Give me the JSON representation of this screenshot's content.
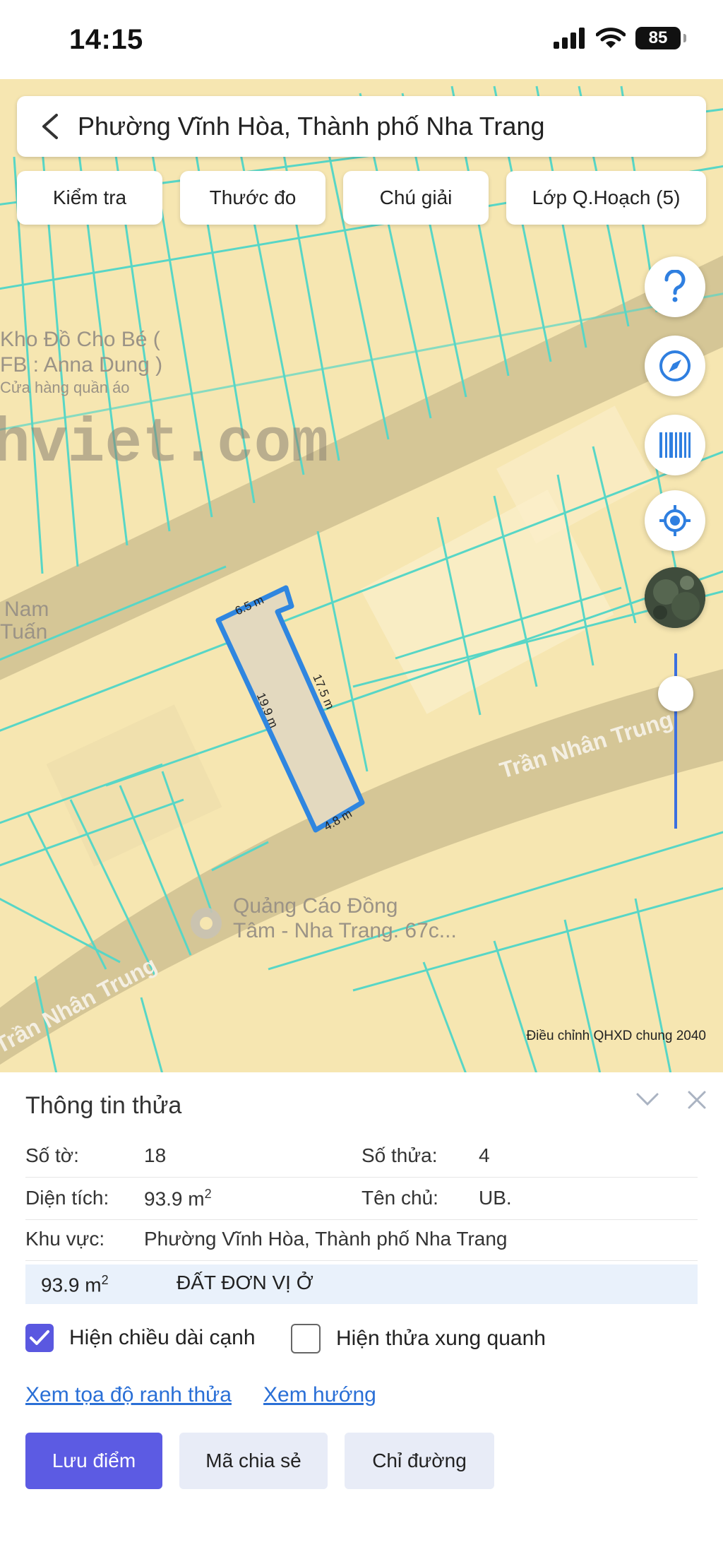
{
  "status": {
    "time": "14:15",
    "battery": "85"
  },
  "search": {
    "title": "Phường Vĩnh Hòa, Thành phố Nha Trang"
  },
  "toolbar": {
    "check": "Kiểm tra",
    "ruler": "Thước đo",
    "legend": "Chú giải",
    "layers": "Lớp Q.Hoạch (5)"
  },
  "map": {
    "labels": {
      "shop1": "Kho Đồ Cho Bé (",
      "shop2": "FB : Anna Dung )",
      "shop3": "Cửa hàng quần áo",
      "watermark": "hviet.com",
      "nam": "Nam",
      "tuan": "Tuấn",
      "street1": "Trần Nhân Trung",
      "street2": "Trần Nhân Trung",
      "poi1": "Quảng Cáo Đồng",
      "poi2": "Tâm - Nha Trang. 67c..."
    },
    "edges": {
      "top": "6.5 m",
      "left": "19.9 m",
      "right": "17.5 m",
      "bottom": "4.8 m"
    },
    "note": "Điều chỉnh QHXD chung 2040",
    "colors": {
      "land": "#f6e6b1",
      "road": "#cfbf92",
      "parcel": "#58d6c6",
      "highlight": "#2f86e0"
    }
  },
  "panel": {
    "title": "Thông tin thửa",
    "sheet_label": "Số tờ:",
    "sheet_value": "18",
    "parcel_label": "Số thửa:",
    "parcel_value": "4",
    "area_label": "Diện tích:",
    "area_value": "93.9 m",
    "area_sup": "2",
    "owner_label": "Tên chủ:",
    "owner_value": "UB.",
    "region_label": "Khu vực:",
    "region_value": "Phường Vĩnh Hòa, Thành phố Nha Trang",
    "landuse_area": "93.9 m",
    "landuse_sup": "2",
    "landuse_type": "ĐẤT ĐƠN VỊ Ở",
    "opt_edges": "Hiện chiều dài cạnh",
    "opt_neighbors": "Hiện thửa xung quanh",
    "link_coords": "Xem tọa độ ranh thửa",
    "link_direction": "Xem hướng",
    "btn_save": "Lưu điểm",
    "btn_share": "Mã chia sẻ",
    "btn_route": "Chỉ đường"
  }
}
